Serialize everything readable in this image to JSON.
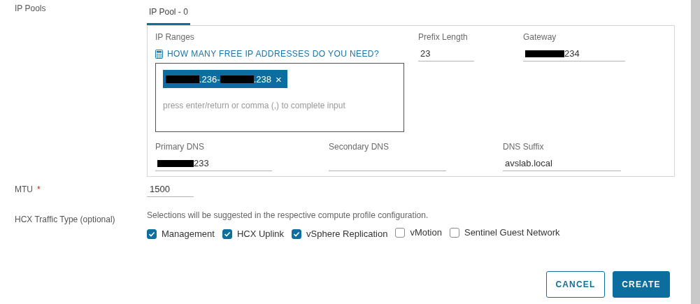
{
  "ip_pools": {
    "label": "IP Pools",
    "tabs": [
      {
        "label": "IP Pool - 0",
        "selected": true
      }
    ],
    "ip_ranges": {
      "label": "IP Ranges",
      "help_link": "HOW MANY FREE IP ADDRESSES DO YOU NEED?",
      "chips": [
        {
          "segments": [
            {
              "redacted": true,
              "text": ".236-"
            },
            {
              "redacted": true,
              "text": ".238"
            }
          ],
          "remove": "×"
        }
      ],
      "placeholder": "press enter/return or comma (,) to complete input"
    },
    "fields": [
      {
        "label": "Prefix Length",
        "redacted": false,
        "value": "23"
      },
      {
        "label": "Gateway",
        "redacted": true,
        "value": "234"
      },
      {
        "label": "Primary DNS",
        "redacted": true,
        "value": "233"
      },
      {
        "label": "Secondary DNS",
        "redacted": false
      },
      {
        "label": "DNS Suffix",
        "redacted": false,
        "value": "avslab.local"
      }
    ]
  },
  "mtu": {
    "label": "MTU",
    "required_mark": "*",
    "value": "1500"
  },
  "traffic_type": {
    "label": "HCX Traffic Type (optional)",
    "hint": "Selections will be suggested in the respective compute profile configuration.",
    "options": [
      {
        "label": "Management",
        "checked": true
      },
      {
        "label": "HCX Uplink",
        "checked": true
      },
      {
        "label": "vSphere Replication",
        "checked": true
      },
      {
        "label": "vMotion",
        "checked": false
      },
      {
        "label": "Sentinel Guest Network",
        "checked": false
      }
    ]
  },
  "buttons": [
    {
      "label": "CANCEL",
      "kind": "outline"
    },
    {
      "label": "CREATE",
      "kind": "primary"
    }
  ]
}
